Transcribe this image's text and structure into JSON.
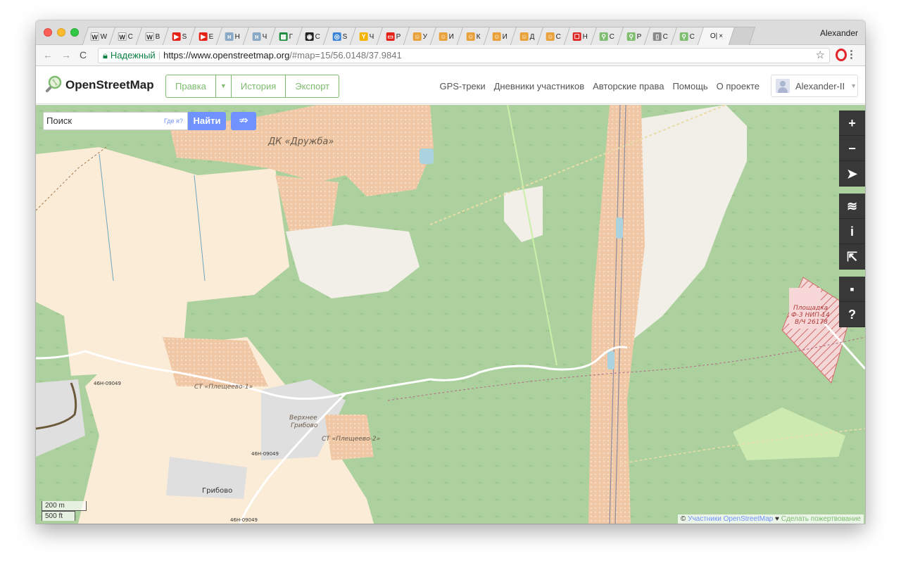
{
  "browser": {
    "profile_name": "Alexander",
    "tabs": [
      {
        "favicon": "W",
        "label": "W",
        "color": "#ffffff"
      },
      {
        "favicon": "W",
        "label": "С",
        "color": "#ffffff"
      },
      {
        "favicon": "W",
        "label": "В",
        "color": "#ffffff"
      },
      {
        "favicon": "▶",
        "label": "S",
        "color": "#e62117"
      },
      {
        "favicon": "▶",
        "label": "Е",
        "color": "#e62117"
      },
      {
        "favicon": "н",
        "label": "Н",
        "color": "#8aa9c7"
      },
      {
        "favicon": "н",
        "label": "Ч",
        "color": "#8aa9c7"
      },
      {
        "favicon": "▦",
        "label": "Г",
        "color": "#1e8e3e"
      },
      {
        "favicon": "◉",
        "label": "С",
        "color": "#222222"
      },
      {
        "favicon": "◎",
        "label": "S",
        "color": "#3a85d9"
      },
      {
        "favicon": "Y",
        "label": "Ч",
        "color": "#f4b400"
      },
      {
        "favicon": "▭",
        "label": "Р",
        "color": "#e62117"
      },
      {
        "favicon": "☺",
        "label": "У",
        "color": "#e9a23b"
      },
      {
        "favicon": "☺",
        "label": "И",
        "color": "#e9a23b"
      },
      {
        "favicon": "☺",
        "label": "К",
        "color": "#e9a23b"
      },
      {
        "favicon": "☺",
        "label": "И",
        "color": "#e9a23b"
      },
      {
        "favicon": "☺",
        "label": "Д",
        "color": "#e9a23b"
      },
      {
        "favicon": "☺",
        "label": "С",
        "color": "#e9a23b"
      },
      {
        "favicon": "☐",
        "label": "Н",
        "color": "#d22"
      },
      {
        "favicon": "⚲",
        "label": "С",
        "color": "#7ebc6f"
      },
      {
        "favicon": "⚲",
        "label": "Р",
        "color": "#7ebc6f"
      },
      {
        "favicon": "▯",
        "label": "С",
        "color": "#888888"
      },
      {
        "favicon": "⚲",
        "label": "С",
        "color": "#7ebc6f"
      }
    ],
    "active_tab": {
      "label": "О|",
      "close": "×"
    },
    "secure_label": "Надежный",
    "url_host": "https://www.openstreetmap.org",
    "url_path": "/#map=15/56.0148/37.9841"
  },
  "osm": {
    "logo_text": "OpenStreetMap",
    "edit_label": "Правка",
    "history_label": "История",
    "export_label": "Экспорт",
    "nav": [
      "GPS-треки",
      "Дневники участников",
      "Авторские права",
      "Помощь",
      "О проекте"
    ],
    "user": "Alexander-II"
  },
  "map": {
    "search_placeholder": "Поиск",
    "where_am_i": "Где я?",
    "search_button": "Найти",
    "scale_m": "200 m",
    "scale_ft": "500 ft",
    "attribution_prefix": "©",
    "attribution_link": "Участники OpenStreetMap",
    "attribution_heart": "♥",
    "attribution_donate": "Сделать пожертвование",
    "labels": {
      "dk": "ДК «Дружба»",
      "st1": "СТ «Плещеево-1»",
      "st2": "СТ «Плещеево-2»",
      "village1": "Верхнее",
      "village2": "Грибово",
      "gribovo": "Грибово",
      "road1": "46Н-09049",
      "road2": "46Н-09049",
      "road3": "46Н-09049",
      "site1": "Площадка",
      "site2": "Ф-3 НИП-14",
      "site3": "В/Ч 26178"
    },
    "colors": {
      "forest": "#add19e",
      "farmland": "#fbecd7",
      "residential": "#e0dfdf",
      "allotments": "#eecfb3",
      "railway": "#f2c7a6",
      "meadow": "#cdebb0",
      "military": "#f1c9c9",
      "accent": "#7ebc6f",
      "search_blue": "#7092ff"
    }
  }
}
